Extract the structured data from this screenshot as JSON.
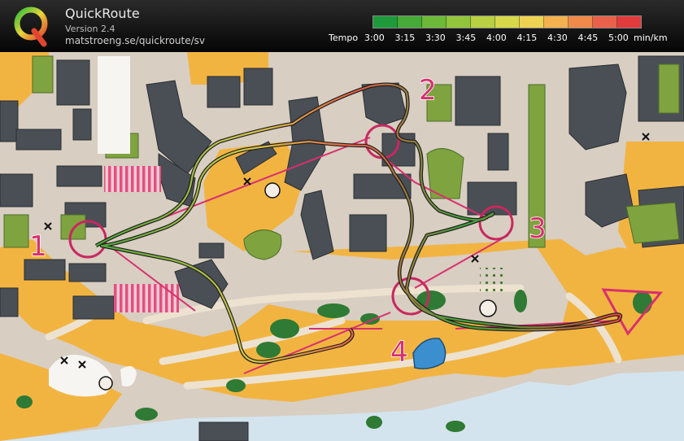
{
  "app": {
    "name": "QuickRoute",
    "version": "Version 2.4",
    "url": "matstroeng.se/quickroute/sv"
  },
  "legend": {
    "title": "Tempo",
    "ticks": [
      "3:00",
      "3:15",
      "3:30",
      "3:45",
      "4:00",
      "4:15",
      "4:30",
      "4:45",
      "5:00"
    ],
    "unit": "min/km",
    "colors": [
      "#1f9a3a",
      "#45aa37",
      "#6db938",
      "#93c53c",
      "#b8d042",
      "#d7d84a",
      "#eed252",
      "#f3b24f",
      "#f08a4a",
      "#e9614a",
      "#e23b3b"
    ]
  },
  "map": {
    "control_numbers": [
      "1",
      "2",
      "3",
      "4"
    ],
    "colors": {
      "forest_open": "#f2b441",
      "paved_area": "#d9cfc3",
      "building": "#4a4f55",
      "vegetation": "#7fa33f",
      "water": "#cfe3ee",
      "course": "#d8306e"
    }
  }
}
